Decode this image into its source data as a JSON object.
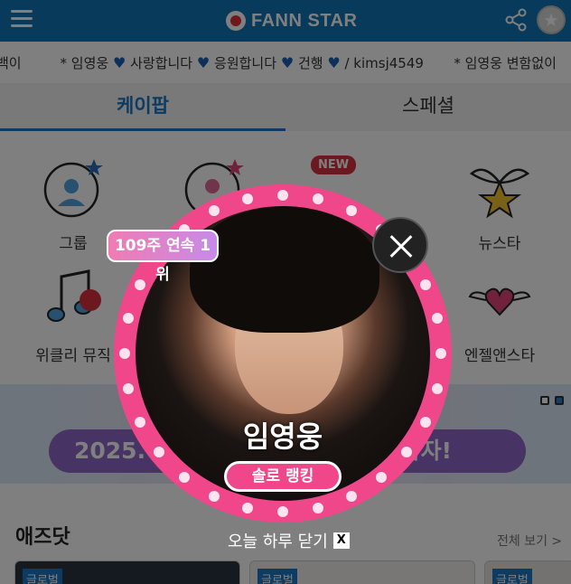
{
  "header": {
    "logo_text": "FANN STAR"
  },
  "ticker": {
    "segments": [
      "백이",
      "* 임영웅",
      "사랑합니다",
      "응원합니다",
      "건행",
      "/ kimsj4549",
      "* 임영웅 변함없이"
    ]
  },
  "tabs": [
    "케이팝",
    "스페셜"
  ],
  "categories": {
    "group": "그룹",
    "newstar": "뉴스타",
    "weekly_music": "위클리 뮤직",
    "angel_star": "엔젤앤스타"
  },
  "badges": {
    "new": "NEW"
  },
  "banner": {
    "date_text": "2025. 02",
    "cta_text": "으러 가자!"
  },
  "section": {
    "title": "애즈닷",
    "see_all": "전체 보기 >",
    "card_badge": "글로벌"
  },
  "popup": {
    "streak": "109주 연속 1위",
    "name": "임영웅",
    "rank_label": "솔로 랭킹",
    "today_close": "오늘 하루 닫기",
    "x_label": "X"
  },
  "colors": {
    "brand": "#0f75b6",
    "accent": "#1a76c2",
    "popup": "#f0478a"
  }
}
